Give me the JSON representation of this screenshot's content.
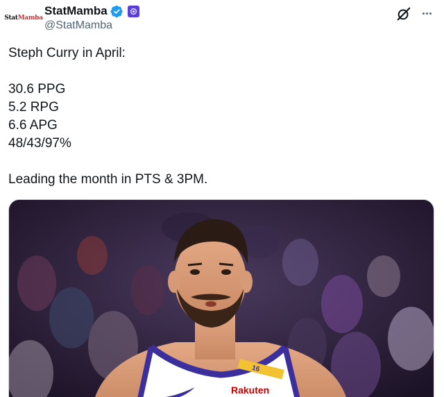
{
  "author": {
    "avatar_text_black": "Stat",
    "avatar_text_red": "Mamba",
    "display_name": "StatMamba",
    "handle": "@StatMamba",
    "verified": true,
    "verified_color": "#1d9bf0",
    "org_badge_color": "#5b3fd6"
  },
  "tweet": {
    "lines": [
      "Steph Curry in April:",
      "",
      "30.6 PPG",
      "5.2 RPG",
      "6.6 APG",
      "48/43/97%",
      "",
      "Leading the month in PTS & 3PM."
    ]
  },
  "media": {
    "jersey_number": "16",
    "jersey_sponsor": "Rakuten",
    "colors": {
      "crowd_bg": "#2a1a3a",
      "jersey": "#ffffff",
      "jersey_trim": "#3b2f9e",
      "sponsor_red": "#bf0000",
      "patch_gold": "#f2c230"
    }
  },
  "icons": {
    "verified": "verified-badge-icon",
    "org": "org-affiliation-badge-icon",
    "grok": "grok-icon",
    "more": "more-options-icon"
  }
}
